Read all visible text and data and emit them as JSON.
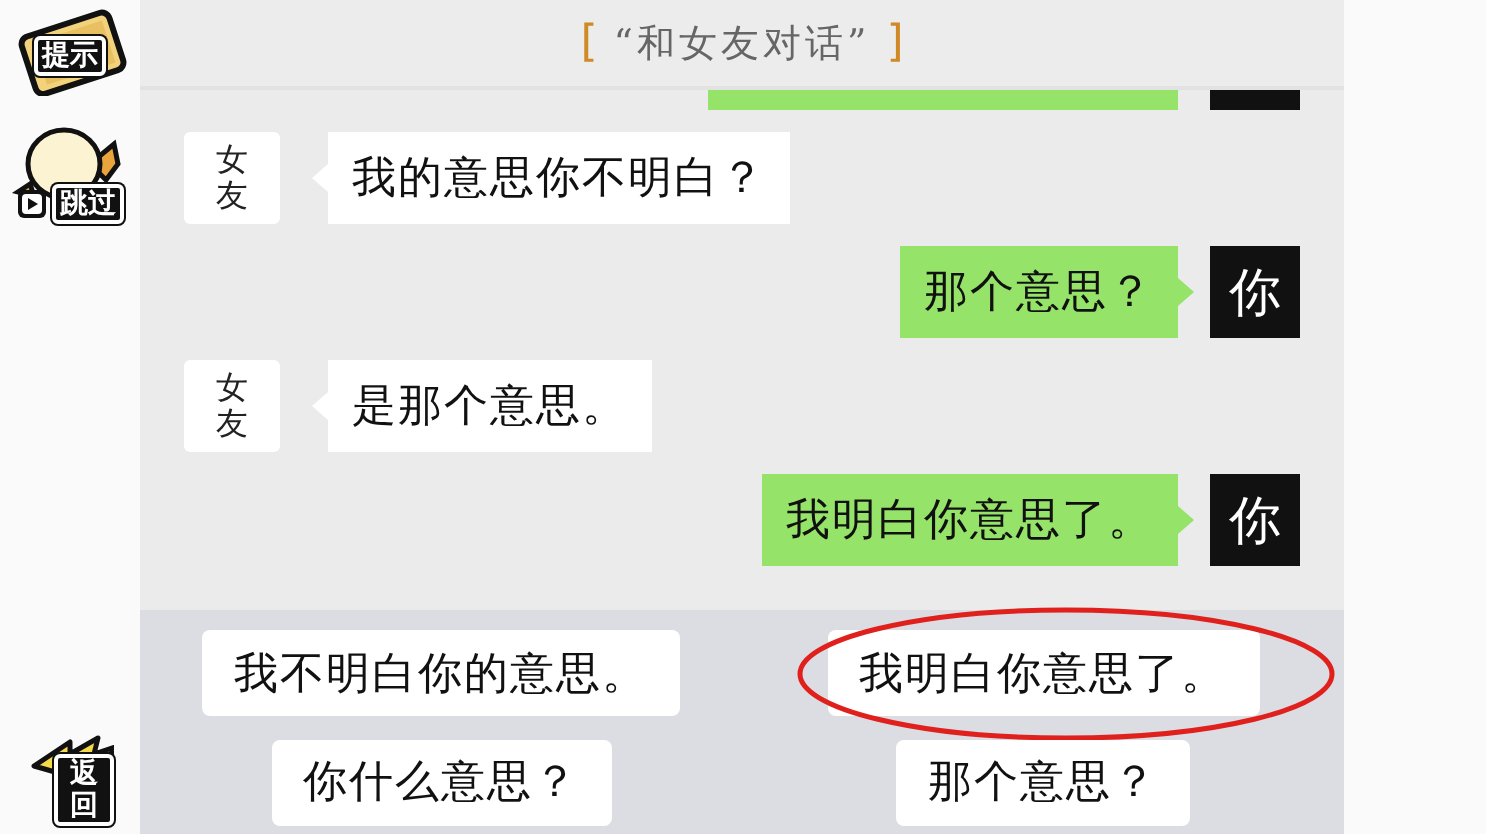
{
  "side_buttons": [
    {
      "kind": "hint",
      "label": "提示"
    },
    {
      "kind": "skip",
      "label": "跳过"
    },
    {
      "kind": "back",
      "label": "返回"
    }
  ],
  "title": {
    "open": "[",
    "text": "“和女友对话”",
    "close": "]"
  },
  "messages": [
    {
      "kind": "sent",
      "cut": true
    },
    {
      "kind": "received",
      "cut": false,
      "avatar": "女友",
      "text": "我的意思你不明白？"
    },
    {
      "kind": "sent",
      "cut": false,
      "avatar": "你",
      "text": "那个意思？"
    },
    {
      "kind": "received",
      "cut": false,
      "avatar": "女友",
      "text": "是那个意思。"
    },
    {
      "kind": "sent",
      "cut": false,
      "avatar": "你",
      "text": "我明白你意思了。"
    }
  ],
  "options": [
    {
      "text": "我不明白你的意思。",
      "selected": false
    },
    {
      "text": "我明白你意思了。",
      "selected": true
    },
    {
      "text": "你什么意思？",
      "selected": false
    },
    {
      "text": "那个意思？",
      "selected": false
    }
  ]
}
